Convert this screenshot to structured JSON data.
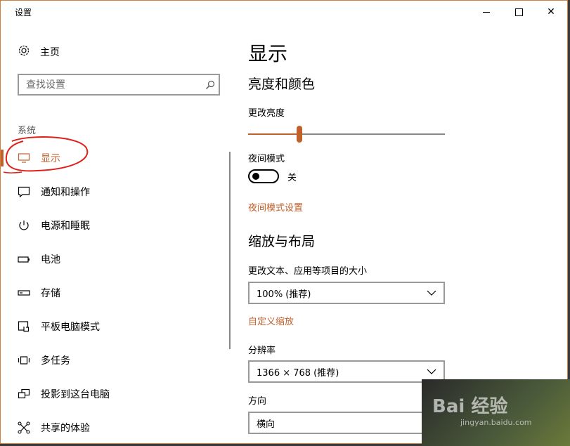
{
  "window": {
    "title": "设置",
    "minimize_icon": "minimize-icon",
    "maximize_icon": "maximize-icon",
    "close_label": "✕"
  },
  "sidebar": {
    "home_label": "主页",
    "search_placeholder": "查找设置",
    "section_label": "系统",
    "items": [
      {
        "label": "显示",
        "icon": "monitor-icon",
        "active": true
      },
      {
        "label": "通知和操作",
        "icon": "notification-icon"
      },
      {
        "label": "电源和睡眠",
        "icon": "power-icon"
      },
      {
        "label": "电池",
        "icon": "battery-icon"
      },
      {
        "label": "存储",
        "icon": "storage-icon"
      },
      {
        "label": "平板电脑模式",
        "icon": "tablet-mode-icon"
      },
      {
        "label": "多任务",
        "icon": "multitasking-icon"
      },
      {
        "label": "投影到这台电脑",
        "icon": "project-icon"
      },
      {
        "label": "共享的体验",
        "icon": "shared-experience-icon"
      }
    ]
  },
  "main": {
    "title": "显示",
    "brightness_section": "亮度和颜色",
    "brightness_label": "更改亮度",
    "brightness_value": 0.26,
    "night_mode_label": "夜间模式",
    "night_mode_state": "关",
    "night_mode_settings_link": "夜间模式设置",
    "scale_section": "缩放与布局",
    "scale_label": "更改文本、应用等项目的大小",
    "scale_value": "100% (推荐)",
    "custom_scale_link": "自定义缩放",
    "resolution_label": "分辨率",
    "resolution_value": "1366 × 768 (推荐)",
    "orientation_label": "方向",
    "orientation_value": "横向"
  },
  "watermark": {
    "text": "Bai 经验",
    "sub": "jingyan.baidu.com"
  },
  "colors": {
    "accent": "#c0602a",
    "annotation": "#e0201a"
  }
}
